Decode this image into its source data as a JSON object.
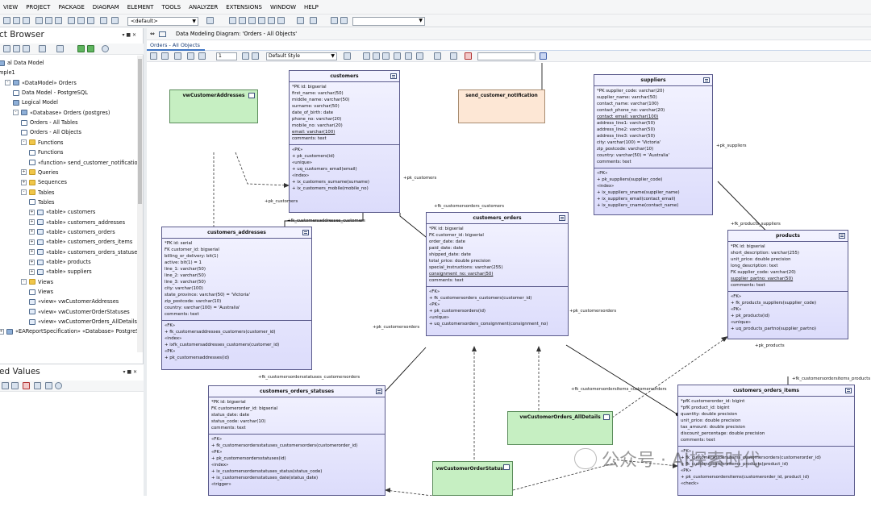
{
  "menu": [
    "VIEW",
    "PROJECT",
    "PACKAGE",
    "DIAGRAM",
    "ELEMENT",
    "TOOLS",
    "ANALYZER",
    "EXTENSIONS",
    "WINDOW",
    "HELP"
  ],
  "toolbar": {
    "default_combo": "<default>"
  },
  "browser": {
    "title": "ct Browser",
    "panel_buttons": "▾ ■ ✕",
    "items": [
      {
        "label": "al Data Model",
        "indent": 0,
        "icon": "pkg"
      },
      {
        "label": "mple1",
        "indent": 0,
        "icon": ""
      },
      {
        "label": "«DataModel» Orders",
        "indent": 1,
        "icon": "pkg",
        "exp": "-"
      },
      {
        "label": "Data Model - PostgreSQL",
        "indent": 2,
        "icon": "diag"
      },
      {
        "label": "Logical Model",
        "indent": 2,
        "icon": "pkg"
      },
      {
        "label": "«Database» Orders (postgres)",
        "indent": 2,
        "icon": "pkg",
        "exp": "-"
      },
      {
        "label": "Orders - All Tables",
        "indent": 3,
        "icon": "diag"
      },
      {
        "label": "Orders - All Objects",
        "indent": 3,
        "icon": "diag"
      },
      {
        "label": "Functions",
        "indent": 3,
        "icon": "folder",
        "exp": "-"
      },
      {
        "label": "Functions",
        "indent": 4,
        "icon": "diag"
      },
      {
        "label": "«function» send_customer_notificatio",
        "indent": 4,
        "icon": "diag"
      },
      {
        "label": "Queries",
        "indent": 3,
        "icon": "folder",
        "exp": "+"
      },
      {
        "label": "Sequences",
        "indent": 3,
        "icon": "folder",
        "exp": "+"
      },
      {
        "label": "Tables",
        "indent": 3,
        "icon": "folder",
        "exp": "-"
      },
      {
        "label": "Tables",
        "indent": 4,
        "icon": "diag"
      },
      {
        "label": "«table» customers",
        "indent": 4,
        "icon": "table",
        "exp": "+"
      },
      {
        "label": "«table» customers_addresses",
        "indent": 4,
        "icon": "table",
        "exp": "+"
      },
      {
        "label": "«table» customers_orders",
        "indent": 4,
        "icon": "table",
        "exp": "+"
      },
      {
        "label": "«table» customers_orders_items",
        "indent": 4,
        "icon": "table",
        "exp": "+"
      },
      {
        "label": "«table» customers_orders_statuses",
        "indent": 4,
        "icon": "table",
        "exp": "+"
      },
      {
        "label": "«table» products",
        "indent": 4,
        "icon": "table",
        "exp": "+"
      },
      {
        "label": "«table» suppliers",
        "indent": 4,
        "icon": "table",
        "exp": "+"
      },
      {
        "label": "Views",
        "indent": 3,
        "icon": "folder",
        "exp": "-"
      },
      {
        "label": "Views",
        "indent": 4,
        "icon": "diag"
      },
      {
        "label": "«view» vwCustomerAddresses",
        "indent": 4,
        "icon": "view"
      },
      {
        "label": "«view» vwCustomerOrderStatuses",
        "indent": 4,
        "icon": "view"
      },
      {
        "label": "«view» vwCustomerOrders_AllDetails",
        "indent": 4,
        "icon": "view"
      },
      {
        "label": "«EAReportSpecification» «Database» PostgreS",
        "indent": 0,
        "icon": "pkg",
        "exp": "+"
      }
    ]
  },
  "tagged": {
    "title": "ed Values",
    "panel_buttons": "▾ ■ ✕"
  },
  "doc_tab": {
    "label": "Data Modeling Diagram: 'Orders - All Objects'"
  },
  "diagram_tab": {
    "label": "Orders - All Objects"
  },
  "diagram_toolbar": {
    "zoom": "1",
    "style": "Default Style"
  },
  "entities": {
    "customers": {
      "title": "customers",
      "cols": [
        "*PK  id: bigserial",
        "        first_name: varchar(50)",
        "        middle_name: varchar(50)",
        "        surname: varchar(50)",
        "        date_of_birth: date",
        "        phone_no: varchar(20)",
        "        mobile_no: varchar(20)",
        "        email: varchar(100)",
        "        comments: text"
      ],
      "ops": [
        "«PK»",
        "+    pk_customers(id)",
        "«unique»",
        "+    uq_customers_email(email)",
        "«index»",
        "+    ix_customers_surname(surname)",
        "+    ix_customers_mobile(mobile_no)"
      ]
    },
    "suppliers": {
      "title": "suppliers",
      "cols": [
        "*PK  supplier_code: varchar(20)",
        "        supplier_name: varchar(50)",
        "        contact_name: varchar(100)",
        "        contact_phone_no: varchar(20)",
        "        contact_email: varchar(100)",
        "        address_line1: varchar(50)",
        "        address_line2: varchar(50)",
        "        address_line3: varchar(50)",
        "        city: varchar(100) = 'Victoria'",
        "        zip_postcode: varchar(10)",
        "        country: varchar(50) = 'Australia'",
        "        comments: text"
      ],
      "ops": [
        "«PK»",
        "+    pk_suppliers(supplier_code)",
        "«index»",
        "+    ix_suppliers_sname(supplier_name)",
        "+    ix_suppliers_email(contact_email)",
        "+    ix_suppliers_cname(contact_name)"
      ]
    },
    "customers_addresses": {
      "title": "customers_addresses",
      "cols": [
        "*PK  id: serial",
        "  FK   customer_id: bigserial",
        "        billing_or_delivery: bit(1)",
        "        active: bit(1) = 1",
        "        line_1: varchar(50)",
        "        line_2: varchar(50)",
        "        line_3: varchar(50)",
        "        city: varchar(100)",
        "        state_province: varchar(50) = 'Victoria'",
        "        zip_postcode: varchar(10)",
        "        country: varchar(100) = 'Australia'",
        "        comments: text"
      ],
      "ops": [
        "«FK»",
        "+    fk_customersaddresses_customers(customer_id)",
        "«index»",
        "+    ixfk_customersaddresses_customers(customer_id)",
        "«PK»",
        "+    pk_customersaddresses(id)"
      ]
    },
    "customers_orders": {
      "title": "customers_orders",
      "cols": [
        "*PK  id: bigserial",
        "  FK   customer_id: bigserial",
        "        order_date: date",
        "        paid_date: date",
        "        shipped_date: date",
        "        total_price: double precision",
        "        special_instructions: varchar(255)",
        "        consignment_no: varchar(50)",
        "        comments: text"
      ],
      "ops": [
        "«FK»",
        "+    fk_customersorders_customers(customer_id)",
        "«PK»",
        "+    pk_customersorders(id)",
        "«unique»",
        "+    uq_customersorders_consignment(consignment_no)"
      ]
    },
    "products": {
      "title": "products",
      "cols": [
        "*PK  id: bigserial",
        "        short_description: varchar(255)",
        "        unit_price: double precision",
        "        long_description: text",
        "  FK   supplier_code: varchar(20)",
        "        supplier_partno: varchar(50)",
        "        comments: text"
      ],
      "ops": [
        "«FK»",
        "+    fk_products_suppliers(supplier_code)",
        "«PK»",
        "+    pk_products(id)",
        "«unique»",
        "+    uq_products_partno(supplier_partno)"
      ]
    },
    "customers_orders_statuses": {
      "title": "customers_orders_statuses",
      "cols": [
        "*PK  id: bigserial",
        "  FK   customerorder_id: bigserial",
        "        status_date: date",
        "        status_code: varchar(10)",
        "        comments: text"
      ],
      "ops": [
        "«FK»",
        "+    fk_customersordersstatuses_customersorders(customerorder_id)",
        "«PK»",
        "+    pk_customersordersstatuses(id)",
        "«index»",
        "+    ix_customersordersstatuses_status(status_code)",
        "+    ix_customersordersstatuses_date(status_date)",
        "«trigger»"
      ]
    },
    "customers_orders_items": {
      "title": "customers_orders_items",
      "cols": [
        "*pfK customerorder_id: bigint",
        "*pfK product_id: bigint",
        "        quantity: double precision",
        "        unit_price: double precision",
        "        tax_amount: double precision",
        "        discount_percentage: double precision",
        "        comments: text"
      ],
      "ops": [
        "«FK»",
        "+    fk_customersordersitems_customersorders(customerorder_id)",
        "+    fk_customersordersitems_products(product_id)",
        "«PK»",
        "+    pk_customersordersitems(customerorder_id, product_id)",
        "«check»"
      ]
    }
  },
  "views": {
    "vwCustomerAddresses": "vwCustomerAddresses",
    "vwCustomerOrders_AllDetails": "vwCustomerOrders_AllDetails",
    "vwCustomerOrderStatuses": "vwCustomerOrderStatuses"
  },
  "function_box": "send_customer_notification",
  "labels": {
    "pk_customers_a": "+pk_customers",
    "pk_customers_b": "+pk_customers",
    "fk_ca": "+fk_customersaddresses_customers",
    "fk_co": "+fk_customersorders_customers",
    "pk_suppliers": "+pk_suppliers",
    "fk_ps": "+fk_products_suppliers",
    "pk_co_a": "+pk_customersorders",
    "pk_co_b": "+pk_customersorders",
    "pk_products": "+pk_products",
    "fk_cos": "+fk_customersordersstatuses_customersorders",
    "fk_coi_co": "+fk_customersordersitems_customersorders",
    "fk_coi_p": "+fk_customersordersitems_products"
  },
  "watermark": "公众号 · AI探索时代"
}
